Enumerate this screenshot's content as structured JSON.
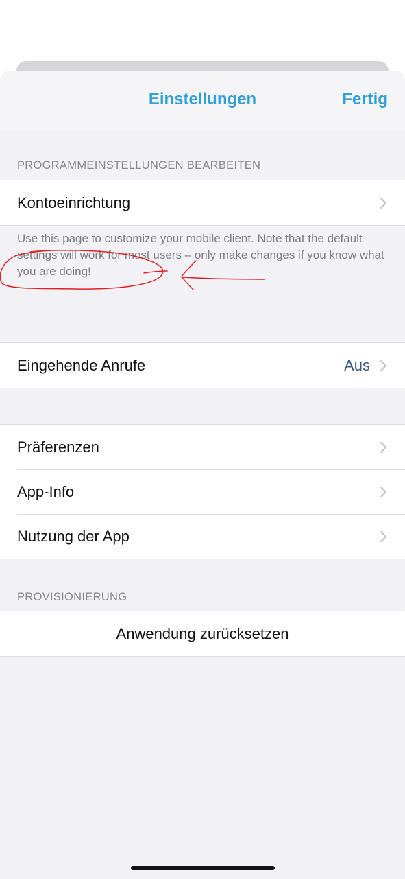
{
  "navbar": {
    "title": "Einstellungen",
    "done_label": "Fertig"
  },
  "sections": {
    "program_settings": {
      "header": "PROGRAMMEINSTELLUNGEN BEARBEITEN",
      "account_setup_label": "Kontoeinrichtung",
      "footer": "Use this page to customize your mobile client. Note that the default settings will work for most users – only make changes if you know what you are doing!"
    },
    "calls": {
      "incoming_calls_label": "Eingehende Anrufe",
      "incoming_calls_value": "Aus"
    },
    "general": {
      "preferences_label": "Präferenzen",
      "app_info_label": "App-Info",
      "app_usage_label": "Nutzung der App"
    },
    "provisioning": {
      "header": "PROVISIONIERUNG",
      "reset_label": "Anwendung zurücksetzen"
    }
  },
  "icons": {
    "chevron": "chevron-right-icon"
  },
  "colors": {
    "accent": "#2f9fd6",
    "value_text": "#3b5a80",
    "annotation": "#e02020",
    "background": "#f1f1f6"
  }
}
